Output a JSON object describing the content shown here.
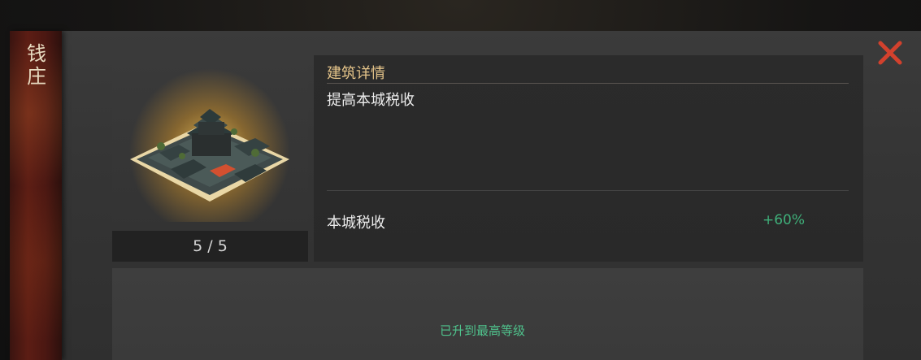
{
  "building": {
    "name": "钱庄",
    "level_text": "5 / 5"
  },
  "details": {
    "title": "建筑详情",
    "description": "提高本城税收"
  },
  "stat": {
    "label": "本城税收",
    "value": "+60%"
  },
  "status": {
    "max_level_text": "已升到最高等级"
  },
  "icons": {
    "close": "close-icon",
    "building": "building-image"
  },
  "colors": {
    "accent_gold": "#e6c58a",
    "stat_green": "#3fb07a",
    "close_red": "#d2412d",
    "banner_red": "#5c1d14"
  }
}
